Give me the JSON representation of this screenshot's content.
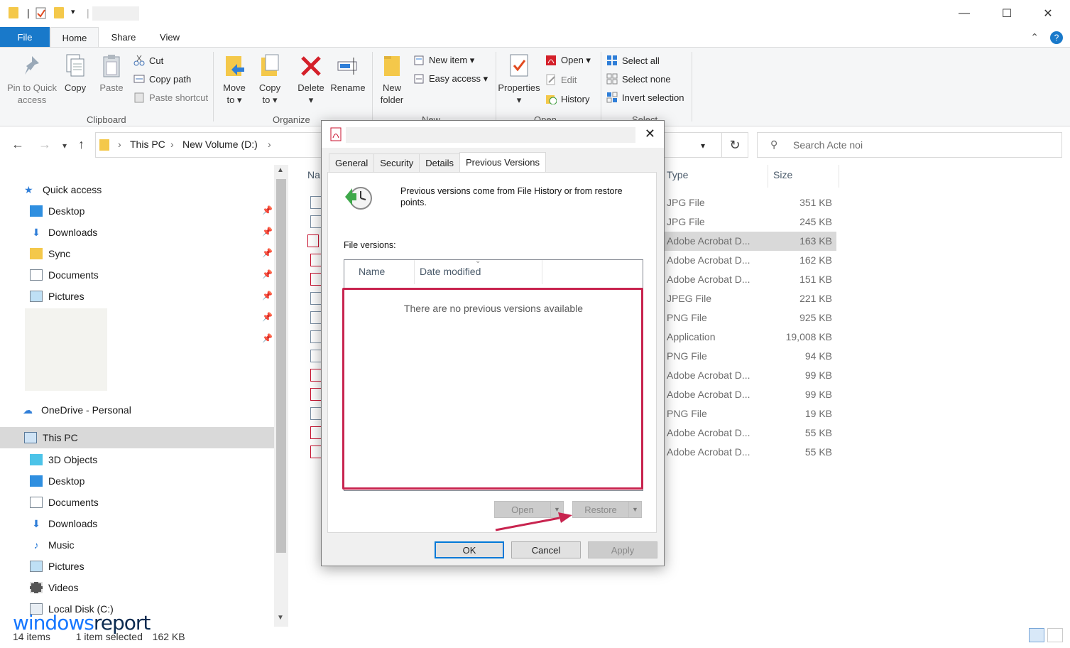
{
  "titlebar": {
    "minimize": "—",
    "maximize": "☐",
    "close": "✕"
  },
  "tabs": {
    "file": "File",
    "home": "Home",
    "share": "Share",
    "view": "View"
  },
  "ribbon": {
    "pin": "Pin to Quick",
    "pin2": "access",
    "copy": "Copy",
    "paste": "Paste",
    "cut": "Cut",
    "copy_path": "Copy path",
    "paste_shortcut": "Paste shortcut",
    "clipboard": "Clipboard",
    "move_to": "Move",
    "move_to2": "to ▾",
    "copy_to": "Copy",
    "copy_to2": "to ▾",
    "delete": "Delete",
    "delete2": "▾",
    "rename": "Rename",
    "organize": "Organize",
    "new_folder": "New",
    "new_folder2": "folder",
    "new_item": "New item ▾",
    "easy_access": "Easy access ▾",
    "new_group": "New",
    "properties": "Properties",
    "properties2": "▾",
    "open": "Open ▾",
    "edit": "Edit",
    "history": "History",
    "open_group": "Open",
    "select_all": "Select all",
    "select_none": "Select none",
    "invert_selection": "Invert selection",
    "select_group": "Select"
  },
  "address": {
    "crumbs": [
      "This PC",
      "New Volume (D:)"
    ],
    "search_placeholder": "Search Acte noi"
  },
  "nav": {
    "quick_access": "Quick access",
    "qa_items": [
      "Desktop",
      "Downloads",
      "Sync",
      "Documents",
      "Pictures"
    ],
    "onedrive": "OneDrive - Personal",
    "this_pc": "This PC",
    "pc_items": [
      "3D Objects",
      "Desktop",
      "Documents",
      "Downloads",
      "Music",
      "Pictures",
      "Videos",
      "Local Disk (C:)"
    ]
  },
  "files": {
    "headers": {
      "name": "Na",
      "type": "Type",
      "size": "Size"
    },
    "rows": [
      {
        "type": "JPG File",
        "size": "351 KB"
      },
      {
        "type": "JPG File",
        "size": "245 KB"
      },
      {
        "type": "Adobe Acrobat D...",
        "size": "163 KB"
      },
      {
        "type": "Adobe Acrobat D...",
        "size": "162 KB"
      },
      {
        "type": "Adobe Acrobat D...",
        "size": "151 KB"
      },
      {
        "type": "JPEG File",
        "size": "221 KB"
      },
      {
        "type": "PNG File",
        "size": "925 KB"
      },
      {
        "type": "Application",
        "size": "19,008 KB"
      },
      {
        "type": "PNG File",
        "size": "94 KB"
      },
      {
        "type": "Adobe Acrobat D...",
        "size": "99 KB"
      },
      {
        "type": "Adobe Acrobat D...",
        "size": "99 KB"
      },
      {
        "type": "PNG File",
        "size": "19 KB"
      },
      {
        "type": "Adobe Acrobat D...",
        "size": "55 KB"
      },
      {
        "type": "Adobe Acrobat D...",
        "size": "55 KB"
      }
    ]
  },
  "status": {
    "count": "14 items",
    "selected": "1 item selected",
    "size": "162 KB"
  },
  "brand": {
    "part1": "windows",
    "part2": "report"
  },
  "dialog": {
    "close": "✕",
    "tabs": [
      "General",
      "Security",
      "Details",
      "Previous Versions"
    ],
    "info": "Previous versions come from File History or from restore points.",
    "file_versions_label": "File versions:",
    "col_name": "Name",
    "col_date": "Date modified",
    "empty": "There are no previous versions available",
    "open_btn": "Open",
    "restore_btn": "Restore",
    "ok": "OK",
    "cancel": "Cancel",
    "apply": "Apply"
  },
  "colors": {
    "accent": "#1979ca",
    "highlight": "#c8244f"
  }
}
